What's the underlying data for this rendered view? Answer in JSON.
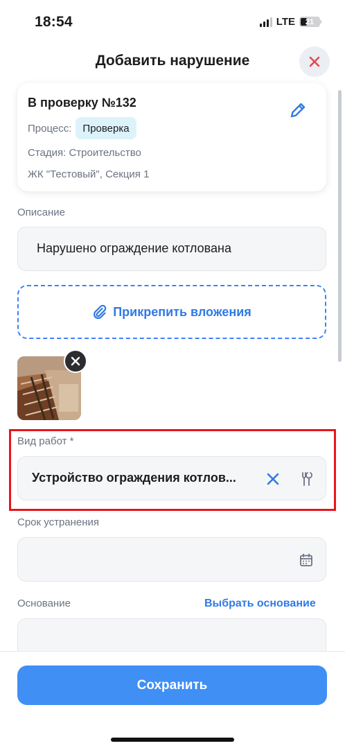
{
  "status_bar": {
    "time": "18:54",
    "network": "LTE",
    "battery": "21",
    "icons": [
      "signal-icon",
      "battery-icon"
    ]
  },
  "header": {
    "title": "Добавить нарушение",
    "close_icon": "close-icon"
  },
  "check_card": {
    "title": "В проверку №132",
    "process_label": "Процесс:",
    "process_value": "Проверка",
    "stage": "Стадия: Строительство",
    "location": "ЖК \"Тестовый\", Секция 1",
    "edit_icon": "pencil-icon"
  },
  "description": {
    "label": "Описание",
    "value": "Нарушено ограждение котлована"
  },
  "attachments": {
    "button_label": "Прикрепить вложения",
    "icon": "paperclip-icon",
    "thumbnail_remove_icon": "close-icon"
  },
  "work_type": {
    "label": "Вид работ *",
    "value": "Устройство ограждения котлов...",
    "clear_icon": "clear-icon",
    "tools_icon": "tools-icon"
  },
  "deadline": {
    "label": "Срок устранения",
    "value": "",
    "icon": "calendar-icon"
  },
  "basis": {
    "label": "Основание",
    "select_link": "Выбрать основание",
    "value": ""
  },
  "footer": {
    "save_label": "Сохранить"
  },
  "colors": {
    "accent": "#3f8ff5",
    "link": "#2f7ae5",
    "danger": "#e5484d",
    "highlight": "#e8141c",
    "chip": "#dcf3fb"
  }
}
